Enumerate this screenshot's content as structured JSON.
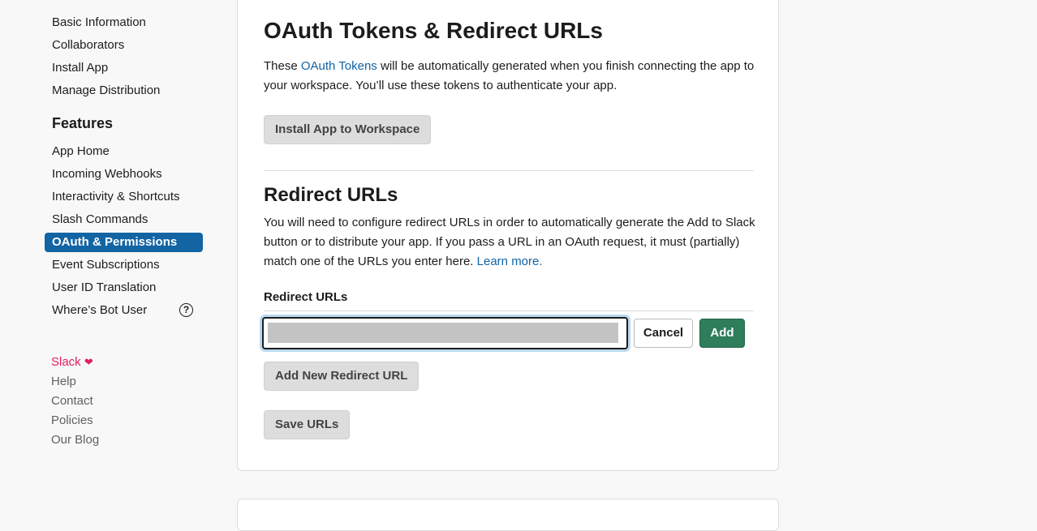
{
  "sidebar": {
    "settings_items": [
      {
        "label": "Basic Information"
      },
      {
        "label": "Collaborators"
      },
      {
        "label": "Install App"
      },
      {
        "label": "Manage Distribution"
      }
    ],
    "features_heading": "Features",
    "feature_items": [
      {
        "label": "App Home",
        "active": false
      },
      {
        "label": "Incoming Webhooks",
        "active": false
      },
      {
        "label": "Interactivity & Shortcuts",
        "active": false
      },
      {
        "label": "Slash Commands",
        "active": false
      },
      {
        "label": "OAuth & Permissions",
        "active": true
      },
      {
        "label": "Event Subscriptions",
        "active": false
      },
      {
        "label": "User ID Translation",
        "active": false
      },
      {
        "label": "Where’s Bot User",
        "active": false,
        "icon": "help-circle-icon"
      }
    ],
    "footer": {
      "brand": "Slack",
      "brand_icon": "heart-icon",
      "links": [
        {
          "label": "Help"
        },
        {
          "label": "Contact"
        },
        {
          "label": "Policies"
        },
        {
          "label": "Our Blog"
        }
      ]
    }
  },
  "main": {
    "oauth_section": {
      "title": "OAuth Tokens & Redirect URLs",
      "desc_before": "These ",
      "desc_link": "OAuth Tokens",
      "desc_after": " will be automatically generated when you finish connecting the app to your workspace. You’ll use these tokens to authenticate your app.",
      "install_button": "Install App to Workspace"
    },
    "redirect_section": {
      "title": "Redirect URLs",
      "desc": "You will need to configure redirect URLs in order to automatically generate the Add to Slack button or to distribute your app. If you pass a URL in an OAuth request, it must (partially) match one of the URLs you enter here. ",
      "desc_link": "Learn more.",
      "field_label": "Redirect URLs",
      "input_value": "",
      "cancel_button": "Cancel",
      "add_button": "Add",
      "add_new_button": "Add New Redirect URL",
      "save_button": "Save URLs"
    }
  },
  "colors": {
    "accent_blue": "#1264a3",
    "add_green": "#2e7d5b",
    "brand_pink": "#e01e5a"
  }
}
